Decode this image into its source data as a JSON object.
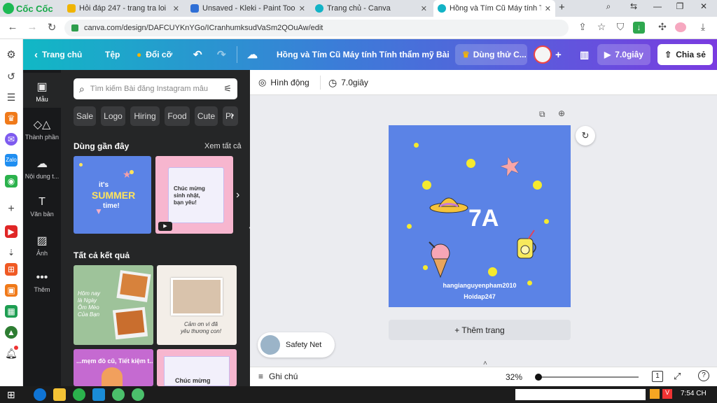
{
  "browser": {
    "brand": "Cốc Cốc",
    "tabs": [
      {
        "label": "Hỏi đáp 247 - trang tra loi",
        "color": "#f0b400"
      },
      {
        "label": "Unsaved - Kleki - Paint Tool",
        "color": "#2f6fd6"
      },
      {
        "label": "Trang chủ - Canva",
        "color": "#12b3c6"
      },
      {
        "label": "Hồng và Tím Cũ Máy tính Tí",
        "color": "#12b3c6"
      }
    ],
    "new_tab": "+",
    "url": "canva.com/design/DAFCUYKnYGo/ICranhumksudVaSm2QOuAw/edit"
  },
  "canva_header": {
    "home": "Trang chủ",
    "file": "Tệp",
    "upgrade": "Đổi cỡ",
    "title": "Hồng và Tím Cũ Máy tính Tính thẩm mỹ Bài ...",
    "try_label": "Dùng thử C...",
    "plus": "+",
    "play": "7.0giây",
    "share": "Chia sẻ"
  },
  "left_nav": [
    {
      "label": "Mẫu",
      "icon": "template-icon",
      "glyph": "▣"
    },
    {
      "label": "Thành phần",
      "icon": "elements-icon",
      "glyph": "◇△"
    },
    {
      "label": "Nội dung t...",
      "icon": "upload-icon",
      "glyph": "☁"
    },
    {
      "label": "Văn bản",
      "icon": "text-icon",
      "glyph": "T"
    },
    {
      "label": "Ảnh",
      "icon": "photo-icon",
      "glyph": "▨"
    },
    {
      "label": "Thêm",
      "icon": "more-icon",
      "glyph": "•••"
    }
  ],
  "panel": {
    "search_placeholder": "Tìm kiếm Bài đăng Instagram mẫu",
    "chips": [
      "Sale",
      "Logo",
      "Hiring",
      "Food",
      "Cute",
      "Pr"
    ],
    "recent_title": "Dùng gần đây",
    "see_all": "Xem tất cả",
    "all_results": "Tất cả kết quả",
    "thumb1_texts": [
      "it's",
      "SUMMER",
      "time!"
    ],
    "thumb2_texts": [
      "Chúc mừng",
      "sinh nhật,",
      "bạn yêu!"
    ],
    "thumb3_texts": [
      "Hôm nay",
      "là Ngày",
      "Ôm Mèo",
      "Của Bạn"
    ],
    "thumb4_texts": [
      "Cảm ơn vì đã",
      "yêu thương con!"
    ],
    "thumb5_texts": [
      "...mẹm đồ cũ, Tiết kiệm t..."
    ],
    "thumb6_texts": [
      "Chúc mừng"
    ]
  },
  "toolbar2": {
    "animate": "Hình động",
    "duration": "7.0giây"
  },
  "design": {
    "title": "7A",
    "author": "hangianguyenpham2010",
    "site": "Hoidap247",
    "bg": "#5b83e6"
  },
  "add_page": "+ Thêm trang",
  "safety": "Safety Net",
  "bottom": {
    "notes": "Ghi chú",
    "zoom": "32%",
    "page_count": "1"
  },
  "taskbar": {
    "time": "7:54 CH"
  }
}
